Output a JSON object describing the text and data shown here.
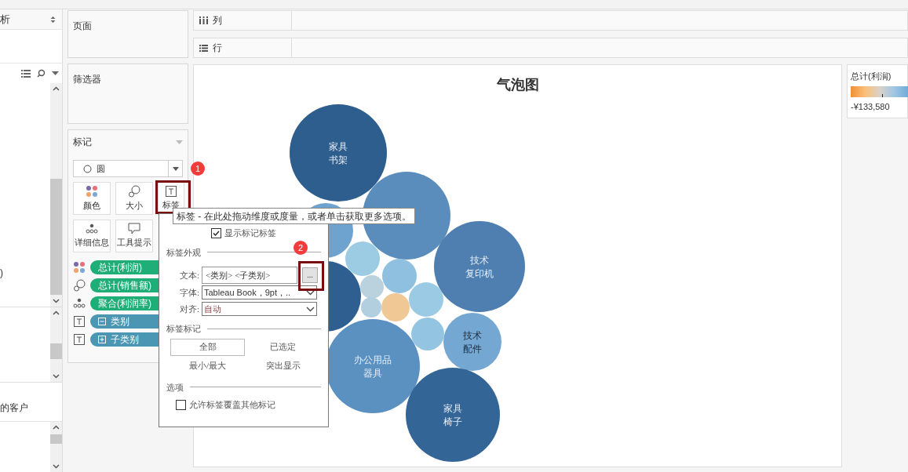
{
  "left_panel": {
    "header": "析",
    "fragments": [
      ")",
      "的客户"
    ]
  },
  "shelves": {
    "pages": "页面",
    "filters": "筛选器",
    "columns": "列",
    "rows": "行"
  },
  "marks_card": {
    "title": "标记",
    "mark_type": "圆",
    "buttons": [
      {
        "kind": "color",
        "label": "颜色",
        "highlighted": false
      },
      {
        "kind": "size",
        "label": "大小",
        "highlighted": false
      },
      {
        "kind": "label",
        "label": "标签",
        "highlighted": true
      },
      {
        "kind": "detail",
        "label": "详细信息",
        "highlighted": false
      },
      {
        "kind": "tooltip",
        "label": "工具提示",
        "highlighted": false
      }
    ],
    "pills": [
      {
        "kind": "color",
        "field": "总计(利润)",
        "color": "#1fae78"
      },
      {
        "kind": "size",
        "field": "总计(销售额)",
        "color": "#1fae78"
      },
      {
        "kind": "detail",
        "field": "聚合(利润率)",
        "color": "#1fae78"
      },
      {
        "kind": "label",
        "field": "类别",
        "color": "#4a96b3",
        "expanded": true
      },
      {
        "kind": "label",
        "field": "子类别",
        "color": "#4a96b3",
        "expanded": false
      }
    ]
  },
  "step_badges": [
    "1",
    "2"
  ],
  "tooltip": "标签 - 在此处拖动维度或度量，或者单击获取更多选项。",
  "label_popup": {
    "show_labels": {
      "label": "显示标记标签",
      "checked": true
    },
    "appearance": {
      "title": "标签外观",
      "text_label": "文本:",
      "text_value": "<类别> <子类别>",
      "more_button": "...",
      "more_highlighted": true,
      "font_label": "字体:",
      "font_value": "Tableau Book，9pt，..",
      "align_label": "对齐:",
      "align_value": "自动"
    },
    "marks_to_label": {
      "title": "标签标记",
      "options": [
        {
          "label": "全部",
          "selected": true
        },
        {
          "label": "已选定",
          "selected": false
        },
        {
          "label": "最小/最大",
          "selected": false
        },
        {
          "label": "突出显示",
          "selected": false
        }
      ]
    },
    "options": {
      "title": "选项",
      "overlap": {
        "label": "允许标签覆盖其他标记",
        "checked": false
      }
    }
  },
  "chart": {
    "title": "气泡图",
    "bubbles": [
      {
        "lines": [
          "家具",
          "书架"
        ],
        "color": "#2e5e8e"
      },
      {
        "color": "#5a8cbc"
      },
      {
        "color": "#6fa3cf"
      },
      {
        "lines": [
          "技术",
          "复印机"
        ],
        "color": "#4e7fb0"
      },
      {
        "lines": [
          "技术",
          "配件"
        ],
        "color": "#74a8d2"
      },
      {
        "lines": [
          "办公用品",
          "器具"
        ],
        "color": "#5b91c1"
      },
      {
        "lines": [
          "家具",
          "椅子"
        ],
        "color": "#336596"
      },
      {
        "color": "#2f5f90"
      },
      {
        "color": "#9ccbe4"
      },
      {
        "color": "#8fc0e0"
      },
      {
        "color": "#b9d2de"
      },
      {
        "color": "#b1cfdf"
      },
      {
        "color": "#f0c896"
      },
      {
        "color": "#9bcbe4"
      },
      {
        "color": "#93c4e2"
      }
    ]
  },
  "legend": {
    "title": "总计(利润)",
    "min_label": "-¥133,580"
  }
}
